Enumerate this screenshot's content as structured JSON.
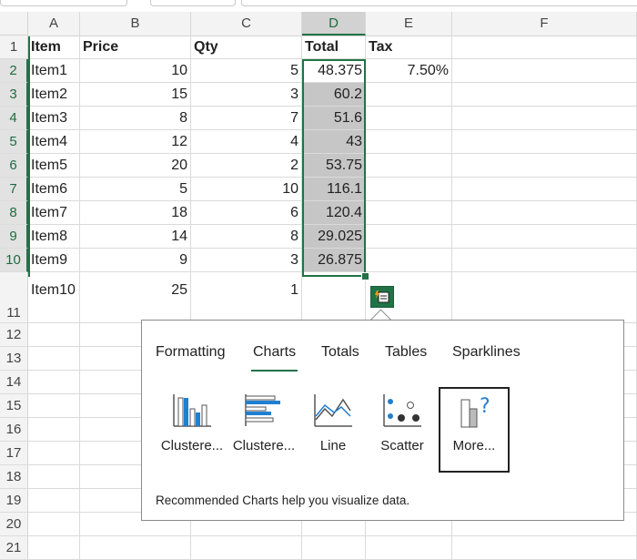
{
  "columns": [
    "A",
    "B",
    "C",
    "D",
    "E",
    "F"
  ],
  "rows": [
    "1",
    "2",
    "3",
    "4",
    "5",
    "6",
    "7",
    "8",
    "9",
    "10",
    "11",
    "12",
    "13",
    "14",
    "15",
    "16",
    "17",
    "18",
    "19",
    "20",
    "21"
  ],
  "headers": {
    "A": "Item",
    "B": "Price",
    "C": "Qty",
    "D": "Total",
    "E": "Tax"
  },
  "data": [
    {
      "item": "Item1",
      "price": "10",
      "qty": "5",
      "total": "48.375",
      "tax": "7.50%"
    },
    {
      "item": "Item2",
      "price": "15",
      "qty": "3",
      "total": "60.2",
      "tax": ""
    },
    {
      "item": "Item3",
      "price": "8",
      "qty": "7",
      "total": "51.6",
      "tax": ""
    },
    {
      "item": "Item4",
      "price": "12",
      "qty": "4",
      "total": "43",
      "tax": ""
    },
    {
      "item": "Item5",
      "price": "20",
      "qty": "2",
      "total": "53.75",
      "tax": ""
    },
    {
      "item": "Item6",
      "price": "5",
      "qty": "10",
      "total": "116.1",
      "tax": ""
    },
    {
      "item": "Item7",
      "price": "18",
      "qty": "6",
      "total": "120.4",
      "tax": ""
    },
    {
      "item": "Item8",
      "price": "14",
      "qty": "8",
      "total": "29.025",
      "tax": ""
    },
    {
      "item": "Item9",
      "price": "9",
      "qty": "3",
      "total": "26.875",
      "tax": ""
    },
    {
      "item": "Item10",
      "price": "25",
      "qty": "1",
      "total": "",
      "tax": ""
    }
  ],
  "quick_analysis": {
    "tabs": [
      "Formatting",
      "Charts",
      "Totals",
      "Tables",
      "Sparklines"
    ],
    "active_tab": "Charts",
    "options": [
      {
        "label": "Clustere...",
        "icon": "clustered-column-chart-icon"
      },
      {
        "label": "Clustere...",
        "icon": "clustered-bar-chart-icon"
      },
      {
        "label": "Line",
        "icon": "line-chart-icon"
      },
      {
        "label": "Scatter",
        "icon": "scatter-chart-icon"
      },
      {
        "label": "More...",
        "icon": "more-charts-icon"
      }
    ],
    "footer": "Recommended Charts help you visualize data."
  },
  "colors": {
    "accent": "#217346",
    "selection_fill": "#c6c6c6",
    "chart_blue": "#1f7fd1"
  }
}
